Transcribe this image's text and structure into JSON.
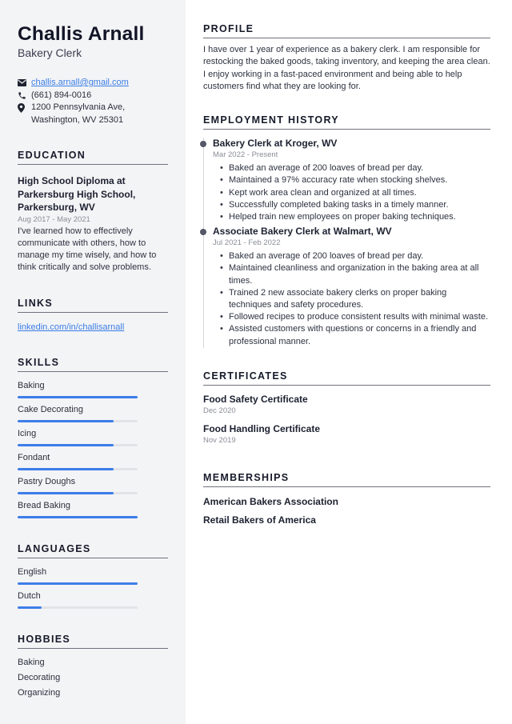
{
  "header": {
    "name": "Challis Arnall",
    "role": "Bakery Clerk"
  },
  "contact": {
    "email": "challis.arnall@gmail.com",
    "phone": "(661) 894-0016",
    "address": "1200 Pennsylvania Ave, Washington, WV 25301",
    "icons": [
      "envelope-icon",
      "phone-icon",
      "map-pin-icon"
    ]
  },
  "education": {
    "title": "EDUCATION",
    "degree": "High School Diploma at Parkersburg High School, Parkersburg, WV",
    "dates": "Aug 2017 - May 2021",
    "description": "I've learned how to effectively communicate with others, how to manage my time wisely, and how to think critically and solve problems."
  },
  "links": {
    "title": "LINKS",
    "items": [
      "linkedin.com/in/challisarnall"
    ]
  },
  "skills": {
    "title": "SKILLS",
    "items": [
      {
        "name": "Baking",
        "level": 100
      },
      {
        "name": "Cake Decorating",
        "level": 80
      },
      {
        "name": "Icing",
        "level": 80
      },
      {
        "name": "Fondant",
        "level": 80
      },
      {
        "name": "Pastry Doughs",
        "level": 80
      },
      {
        "name": "Bread Baking",
        "level": 100
      }
    ]
  },
  "languages": {
    "title": "LANGUAGES",
    "items": [
      {
        "name": "English",
        "level": 100
      },
      {
        "name": "Dutch",
        "level": 20
      }
    ]
  },
  "hobbies": {
    "title": "HOBBIES",
    "items": [
      "Baking",
      "Decorating",
      "Organizing"
    ]
  },
  "profile": {
    "title": "PROFILE",
    "text": "I have over 1 year of experience as a bakery clerk. I am responsible for restocking the baked goods, taking inventory, and keeping the area clean. I enjoy working in a fast-paced environment and being able to help customers find what they are looking for."
  },
  "employment": {
    "title": "EMPLOYMENT HISTORY",
    "jobs": [
      {
        "title": "Bakery Clerk at Kroger, WV",
        "dates": "Mar 2022 - Present",
        "bullets": [
          "Baked an average of 200 loaves of bread per day.",
          "Maintained a 97% accuracy rate when stocking shelves.",
          "Kept work area clean and organized at all times.",
          "Successfully completed baking tasks in a timely manner.",
          "Helped train new employees on proper baking techniques."
        ]
      },
      {
        "title": "Associate Bakery Clerk at Walmart, WV",
        "dates": "Jul 2021 - Feb 2022",
        "bullets": [
          "Baked an average of 200 loaves of bread per day.",
          "Maintained cleanliness and organization in the baking area at all times.",
          "Trained 2 new associate bakery clerks on proper baking techniques and safety procedures.",
          "Followed recipes to produce consistent results with minimal waste.",
          "Assisted customers with questions or concerns in a friendly and professional manner."
        ]
      }
    ]
  },
  "certificates": {
    "title": "CERTIFICATES",
    "items": [
      {
        "name": "Food Safety Certificate",
        "date": "Dec 2020"
      },
      {
        "name": "Food Handling Certificate",
        "date": "Nov 2019"
      }
    ]
  },
  "memberships": {
    "title": "MEMBERSHIPS",
    "items": [
      "American Bakers Association",
      "Retail Bakers of America"
    ]
  },
  "colors": {
    "accent": "#3d7ee8",
    "link": "#3b7de6",
    "sidebar_bg": "#f3f4f6"
  }
}
